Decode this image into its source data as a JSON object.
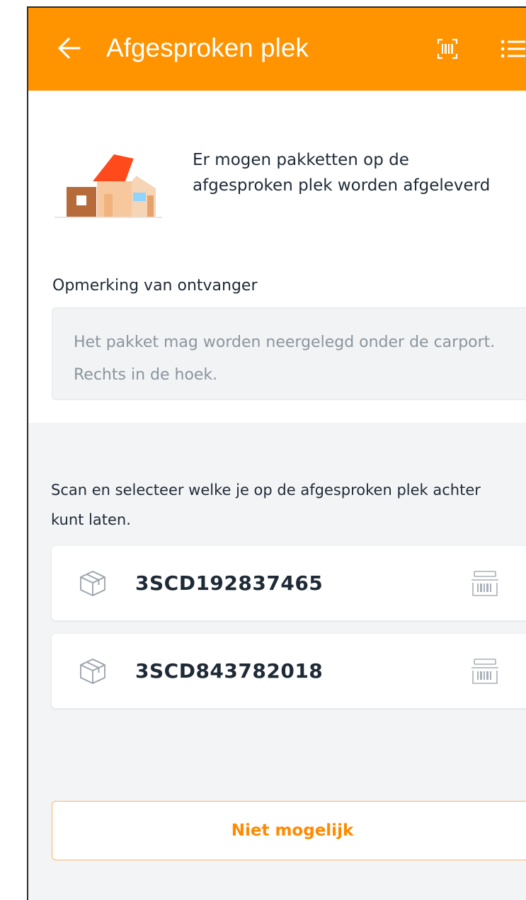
{
  "appbar": {
    "title": "Afgesproken plek",
    "background_color": "#ff9300",
    "icons": [
      "back-arrow-icon",
      "barcode-scan-icon",
      "list-icon"
    ]
  },
  "info": {
    "illustration": "house-icon",
    "text": "Er mogen pakketten op de afgesproken plek worden afgeleverd"
  },
  "remark": {
    "label": "Opmerking van ontvanger",
    "text": "Het pakket mag worden neergelegd onder de carport. Rechts in de hoek."
  },
  "scan": {
    "instruction": "Scan en selecteer welke je op de afgesproken plek achter kunt laten."
  },
  "parcels": [
    {
      "code": "3SCD192837465",
      "icon": "package-box-icon",
      "action_icon": "barcode-icon"
    },
    {
      "code": "3SCD843782018",
      "icon": "package-box-icon",
      "action_icon": "barcode-icon"
    }
  ],
  "actions": {
    "not_possible_label": "Niet mogelijk",
    "accent_color": "#ff8a00"
  }
}
